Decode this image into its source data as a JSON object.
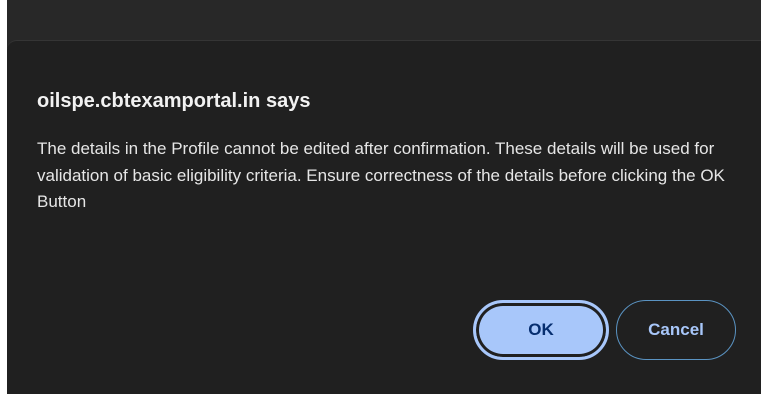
{
  "dialog": {
    "title": "oilspe.cbtexamportal.in says",
    "message": "The details in the Profile cannot be edited after confirmation. These details will be used for validation of basic eligibility criteria. Ensure correctness of the details before clicking the OK Button",
    "ok_label": "OK",
    "cancel_label": "Cancel"
  },
  "colors": {
    "dialog_background": "#202020",
    "accent": "#a8c7fa",
    "ok_text": "#062e6f"
  }
}
